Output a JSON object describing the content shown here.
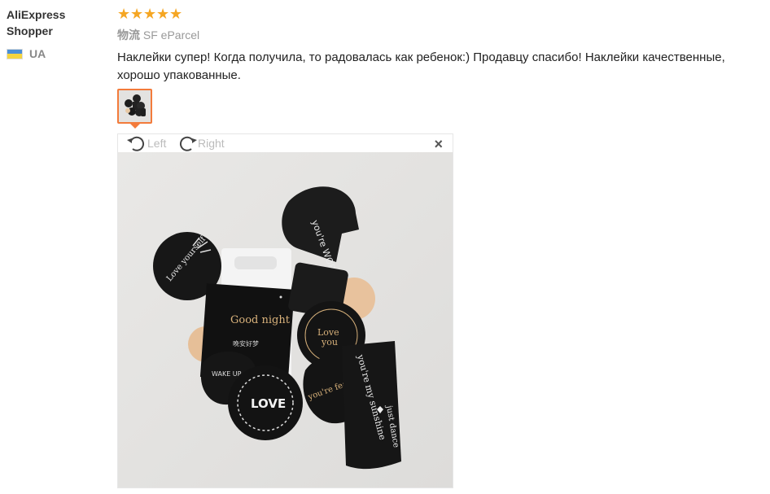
{
  "reviewer": {
    "name_line1": "AliExpress",
    "name_line2": "Shopper",
    "country_code": "UA",
    "flag_colors": {
      "top": "#4a8fd8",
      "bottom": "#f3d440"
    }
  },
  "rating": {
    "stars": 5,
    "star_color": "#f5a623"
  },
  "shipping": {
    "label": "物流",
    "method": "SF eParcel"
  },
  "review": {
    "text": "Наклейки супер! Когда получила, то радовалась как ребенок:) Продавцу спасибо! Наклейки качественные, хорошо упакованные."
  },
  "viewer": {
    "rotate_left_label": "Left",
    "rotate_right_label": "Right",
    "close_label": "×",
    "accent_color": "#f37b3b"
  },
  "stickers": {
    "worth": "you're WORTH it",
    "good_night": "Good night",
    "cjk_caption": "晚安好梦",
    "love_yourself": "Love yourself",
    "you_are_fearless": "you're fearless",
    "wake_up_and_dream": "WAKE UP and DREAM",
    "love": "LOVE",
    "you_are_my_sunshine": "you're my sunshine",
    "just_dance": "just dance"
  }
}
